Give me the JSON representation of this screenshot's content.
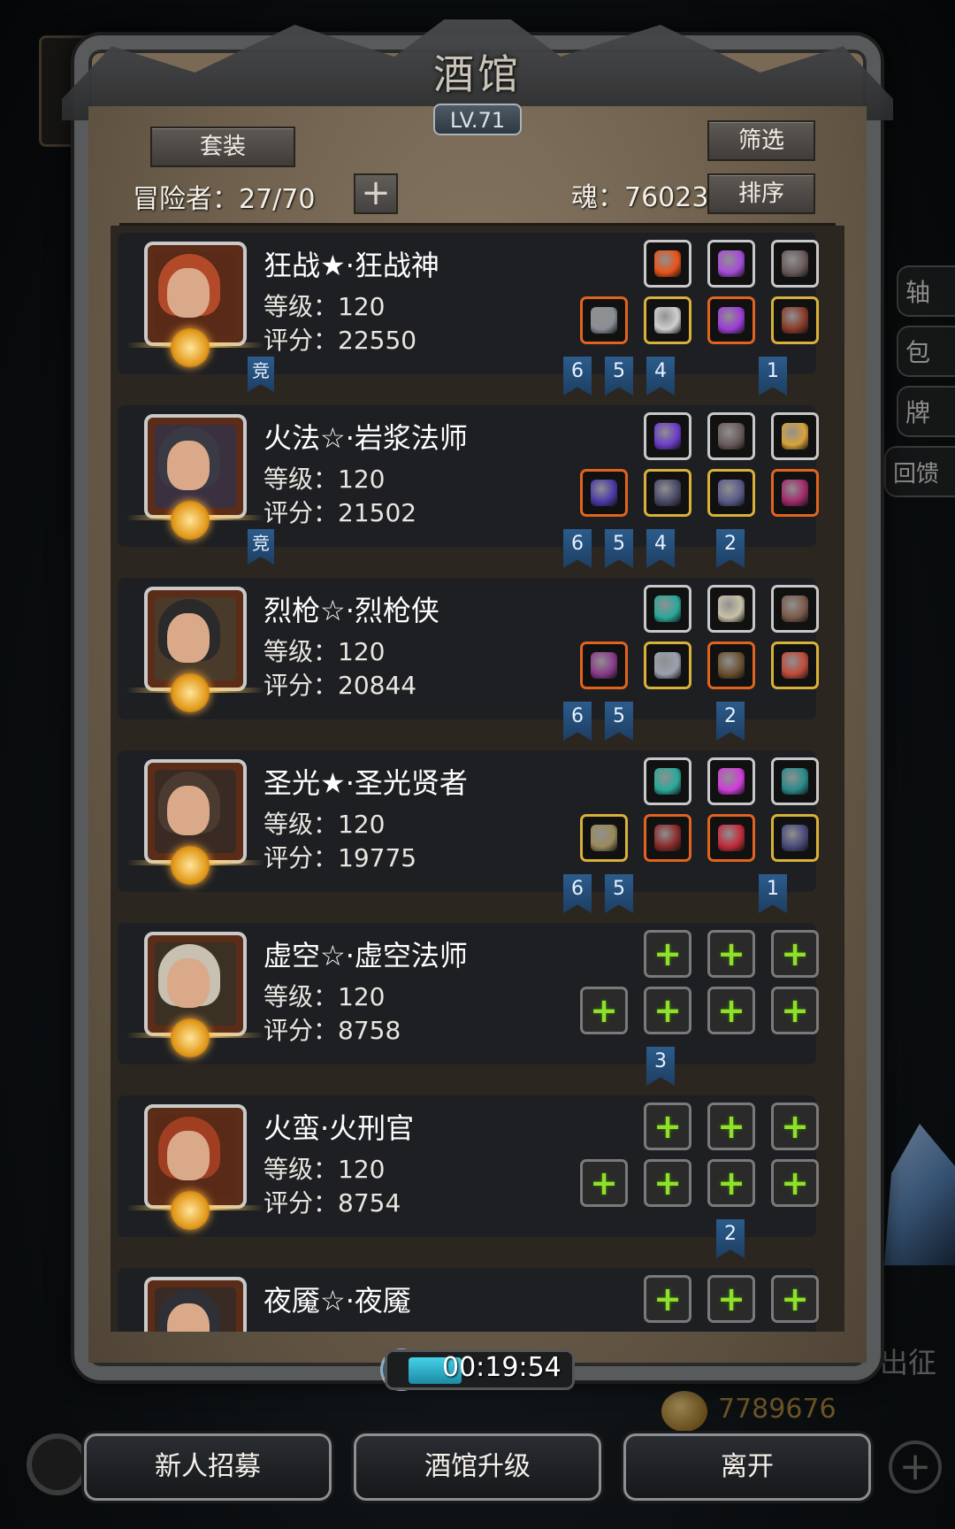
{
  "tavern": {
    "title": "酒馆",
    "level_badge": "LV.71",
    "set_button": "套装",
    "filter_button": "筛选",
    "sort_button": "排序",
    "adventurers_label": "冒险者：27/70",
    "soul_label": "魂：76023",
    "timer": "00:19:54"
  },
  "heroes": [
    {
      "name": "狂战★·狂战神",
      "level": "等级：120",
      "score": "评分：22550",
      "competitive": "竞",
      "row1": [
        {
          "icon": "flame-gem-icon",
          "rarity": "white",
          "color": "#e8531a"
        },
        {
          "icon": "lantern-icon",
          "rarity": "white",
          "color": "#a54bd8"
        },
        {
          "icon": "feather-icon",
          "rarity": "white",
          "color": "#6a5a5a"
        }
      ],
      "row2": [
        {
          "icon": "axe-icon",
          "rarity": "orange",
          "color": "#8a8f96"
        },
        {
          "icon": "armor-icon",
          "rarity": "gold",
          "color": "#cfcfcf"
        },
        {
          "icon": "purple-pendant-icon",
          "rarity": "orange",
          "color": "#9c3cd6"
        },
        {
          "icon": "belt-icon",
          "rarity": "gold",
          "color": "#8a3a2a"
        }
      ],
      "ribbons": [
        "6",
        "5",
        "4",
        "",
        "1"
      ]
    },
    {
      "name": "火法☆·岩浆法师",
      "level": "等级：120",
      "score": "评分：21502",
      "competitive": "竞",
      "row1": [
        {
          "icon": "purple-crystal-icon",
          "rarity": "white",
          "color": "#6a3cc8"
        },
        {
          "icon": "feather-icon",
          "rarity": "white",
          "color": "#6a5a5a"
        },
        {
          "icon": "lantern-icon",
          "rarity": "white",
          "color": "#d8a23a"
        }
      ],
      "row2": [
        {
          "icon": "staff-icon",
          "rarity": "orange",
          "color": "#4a3aa8"
        },
        {
          "icon": "robe-icon",
          "rarity": "gold",
          "color": "#4a4a68"
        },
        {
          "icon": "pentagram-amulet-icon",
          "rarity": "gold",
          "color": "#5a5a8a"
        },
        {
          "icon": "necklace-icon",
          "rarity": "orange",
          "color": "#a02a6a"
        }
      ],
      "ribbons": [
        "6",
        "5",
        "4",
        "2",
        ""
      ]
    },
    {
      "name": "烈枪☆·烈枪侠",
      "level": "等级：120",
      "score": "评分：20844",
      "competitive": "",
      "row1": [
        {
          "icon": "teal-crystal-icon",
          "rarity": "white",
          "color": "#2aa89a"
        },
        {
          "icon": "sword-icon",
          "rarity": "white",
          "color": "#c8c2a8"
        },
        {
          "icon": "shield-icon",
          "rarity": "white",
          "color": "#7a5a4a"
        }
      ],
      "row2": [
        {
          "icon": "spear-icon",
          "rarity": "orange",
          "color": "#8a3a8a"
        },
        {
          "icon": "plate-armor-icon",
          "rarity": "gold",
          "color": "#9aa0ae"
        },
        {
          "icon": "gauntlet-icon",
          "rarity": "orange",
          "color": "#6a5030"
        },
        {
          "icon": "heart-amulet-icon",
          "rarity": "gold",
          "color": "#c04a3a"
        }
      ],
      "ribbons": [
        "6",
        "5",
        "",
        "2",
        ""
      ]
    },
    {
      "name": "圣光★·圣光贤者",
      "level": "等级：120",
      "score": "评分：19775",
      "competitive": "",
      "row1": [
        {
          "icon": "teal-crystal-icon",
          "rarity": "white",
          "color": "#2aa89a"
        },
        {
          "icon": "magenta-gem-icon",
          "rarity": "white",
          "color": "#d03cd8"
        },
        {
          "icon": "turquoise-stone-icon",
          "rarity": "white",
          "color": "#2a8a8a"
        }
      ],
      "row2": [
        {
          "icon": "mace-icon",
          "rarity": "gold",
          "color": "#9a8a5a"
        },
        {
          "icon": "red-robe-icon",
          "rarity": "orange",
          "color": "#8a2a2a"
        },
        {
          "icon": "red-potion-icon",
          "rarity": "orange",
          "color": "#c02a3a"
        },
        {
          "icon": "amulet-icon",
          "rarity": "gold",
          "color": "#4a4a7a"
        }
      ],
      "ribbons": [
        "6",
        "5",
        "",
        "",
        "1"
      ]
    },
    {
      "name": "虚空☆·虚空法师",
      "level": "等级：120",
      "score": "评分：8758",
      "competitive": "",
      "row1": [
        {
          "icon": "empty-slot-plus-icon",
          "rarity": "empty",
          "color": ""
        },
        {
          "icon": "empty-slot-plus-icon",
          "rarity": "empty",
          "color": ""
        },
        {
          "icon": "empty-slot-plus-icon",
          "rarity": "empty",
          "color": ""
        }
      ],
      "row2": [
        {
          "icon": "empty-slot-plus-icon",
          "rarity": "empty",
          "color": ""
        },
        {
          "icon": "empty-slot-plus-icon",
          "rarity": "empty",
          "color": ""
        },
        {
          "icon": "empty-slot-plus-icon",
          "rarity": "empty",
          "color": ""
        },
        {
          "icon": "empty-slot-plus-icon",
          "rarity": "empty",
          "color": ""
        }
      ],
      "ribbons": [
        "",
        "",
        "3",
        "",
        ""
      ]
    },
    {
      "name": "火蛮·火刑官",
      "level": "等级：120",
      "score": "评分：8754",
      "competitive": "",
      "row1": [
        {
          "icon": "empty-slot-plus-icon",
          "rarity": "empty",
          "color": ""
        },
        {
          "icon": "empty-slot-plus-icon",
          "rarity": "empty",
          "color": ""
        },
        {
          "icon": "empty-slot-plus-icon",
          "rarity": "empty",
          "color": ""
        }
      ],
      "row2": [
        {
          "icon": "empty-slot-plus-icon",
          "rarity": "empty",
          "color": ""
        },
        {
          "icon": "empty-slot-plus-icon",
          "rarity": "empty",
          "color": ""
        },
        {
          "icon": "empty-slot-plus-icon",
          "rarity": "empty",
          "color": ""
        },
        {
          "icon": "empty-slot-plus-icon",
          "rarity": "empty",
          "color": ""
        }
      ],
      "ribbons": [
        "",
        "",
        "",
        "2",
        ""
      ]
    },
    {
      "name": "夜魇☆·夜魇",
      "level": "",
      "score": "",
      "competitive": "",
      "row1": [
        {
          "icon": "empty-slot-plus-icon",
          "rarity": "empty",
          "color": ""
        },
        {
          "icon": "empty-slot-plus-icon",
          "rarity": "empty",
          "color": ""
        },
        {
          "icon": "empty-slot-plus-icon",
          "rarity": "empty",
          "color": ""
        }
      ],
      "row2": [],
      "ribbons": []
    }
  ],
  "bottom_buttons": {
    "recruit": "新人招募",
    "upgrade": "酒馆升级",
    "leave": "离开"
  },
  "background": {
    "side_menu": [
      "轴",
      "包",
      "牌",
      "回馈"
    ],
    "expedition_label": "出征",
    "gold": "7789676"
  },
  "colors": {
    "rarity_orange": "#e0641e",
    "rarity_gold": "#d8b13a",
    "rarity_white": "#c8c8c8",
    "plus_green": "#8fe02a",
    "ribbon_blue": "#2c5c8c"
  }
}
